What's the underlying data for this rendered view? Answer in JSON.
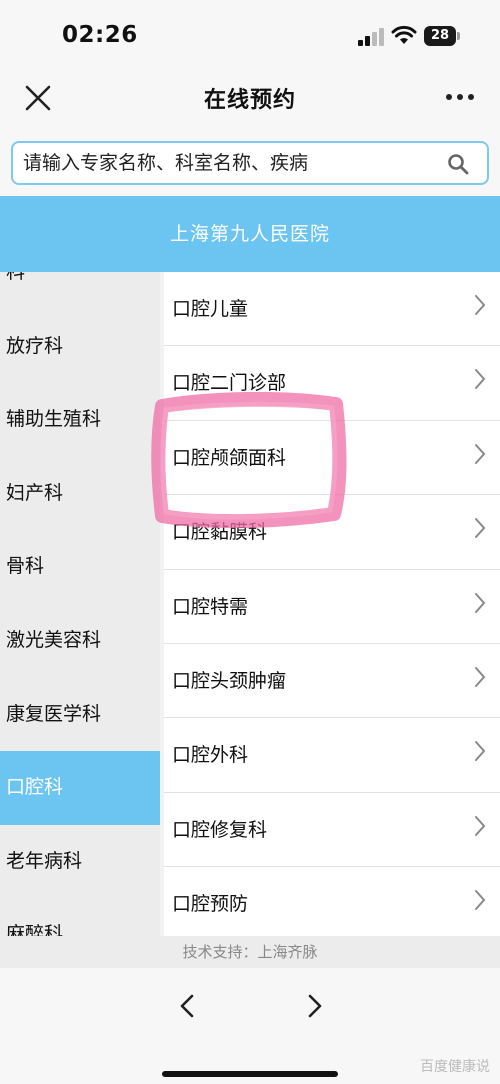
{
  "status": {
    "time": "02:26",
    "battery": "28"
  },
  "nav": {
    "title": "在线预约"
  },
  "search": {
    "placeholder": "请输入专家名称、科室名称、疾病"
  },
  "hospital": {
    "name": "上海第九人民医院"
  },
  "departments": [
    "科",
    "放疗科",
    "辅助生殖科",
    "妇产科",
    "骨科",
    "激光美容科",
    "康复医学科",
    "口腔科",
    "老年病科",
    "麻醉科"
  ],
  "active_department": "口腔科",
  "sub_departments": [
    "口腔儿童",
    "口腔二门诊部",
    "口腔颅颌面科",
    "口腔黏膜科",
    "口腔特需",
    "口腔头颈肿瘤",
    "口腔外科",
    "口腔修复科",
    "口腔预防"
  ],
  "footer": {
    "support": "技术支持：上海齐脉"
  },
  "watermark": "百度健康说",
  "colors": {
    "accent": "#6cc4f0",
    "highlight_mark": "#f06ea8"
  }
}
